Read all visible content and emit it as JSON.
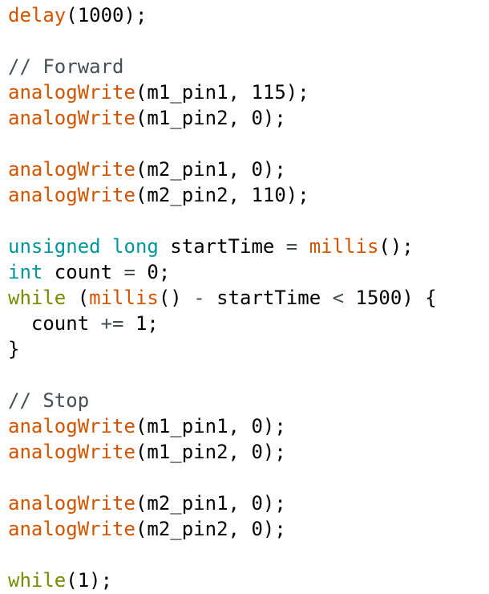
{
  "theme": {
    "function_color": "#d35400",
    "keyword_color": "#728e00",
    "type_color": "#00979c",
    "comment_color": "#434f54",
    "text_color": "#000000",
    "background": "#ffffff"
  },
  "code": {
    "lines": [
      [
        {
          "t": "fn",
          "v": "delay"
        },
        {
          "t": "pl",
          "v": "(1000);"
        }
      ],
      [],
      [
        {
          "t": "cm",
          "v": "// Forward"
        }
      ],
      [
        {
          "t": "fn",
          "v": "analogWrite"
        },
        {
          "t": "pl",
          "v": "(m1_pin1, 115);"
        }
      ],
      [
        {
          "t": "fn",
          "v": "analogWrite"
        },
        {
          "t": "pl",
          "v": "(m1_pin2, 0);"
        }
      ],
      [],
      [
        {
          "t": "fn",
          "v": "analogWrite"
        },
        {
          "t": "pl",
          "v": "(m2_pin1, 0);"
        }
      ],
      [
        {
          "t": "fn",
          "v": "analogWrite"
        },
        {
          "t": "pl",
          "v": "(m2_pin2, 110);"
        }
      ],
      [],
      [
        {
          "t": "type",
          "v": "unsigned"
        },
        {
          "t": "pl",
          "v": " "
        },
        {
          "t": "type",
          "v": "long"
        },
        {
          "t": "pl",
          "v": " startTime "
        },
        {
          "t": "op",
          "v": "="
        },
        {
          "t": "pl",
          "v": " "
        },
        {
          "t": "fn",
          "v": "millis"
        },
        {
          "t": "pl",
          "v": "();"
        }
      ],
      [
        {
          "t": "type",
          "v": "int"
        },
        {
          "t": "pl",
          "v": " count "
        },
        {
          "t": "op",
          "v": "="
        },
        {
          "t": "pl",
          "v": " 0;"
        }
      ],
      [
        {
          "t": "kw",
          "v": "while"
        },
        {
          "t": "pl",
          "v": " ("
        },
        {
          "t": "fn",
          "v": "millis"
        },
        {
          "t": "pl",
          "v": "() "
        },
        {
          "t": "op",
          "v": "-"
        },
        {
          "t": "pl",
          "v": " startTime "
        },
        {
          "t": "op",
          "v": "<"
        },
        {
          "t": "pl",
          "v": " 1500) {"
        }
      ],
      [
        {
          "t": "pl",
          "v": "  count "
        },
        {
          "t": "op",
          "v": "+="
        },
        {
          "t": "pl",
          "v": " 1;"
        }
      ],
      [
        {
          "t": "pl",
          "v": "}"
        }
      ],
      [],
      [
        {
          "t": "cm",
          "v": "// Stop"
        }
      ],
      [
        {
          "t": "fn",
          "v": "analogWrite"
        },
        {
          "t": "pl",
          "v": "(m1_pin1, 0);"
        }
      ],
      [
        {
          "t": "fn",
          "v": "analogWrite"
        },
        {
          "t": "pl",
          "v": "(m1_pin2, 0);"
        }
      ],
      [],
      [
        {
          "t": "fn",
          "v": "analogWrite"
        },
        {
          "t": "pl",
          "v": "(m2_pin1, 0);"
        }
      ],
      [
        {
          "t": "fn",
          "v": "analogWrite"
        },
        {
          "t": "pl",
          "v": "(m2_pin2, 0);"
        }
      ],
      [],
      [
        {
          "t": "kw",
          "v": "while"
        },
        {
          "t": "pl",
          "v": "(1);"
        }
      ]
    ]
  }
}
